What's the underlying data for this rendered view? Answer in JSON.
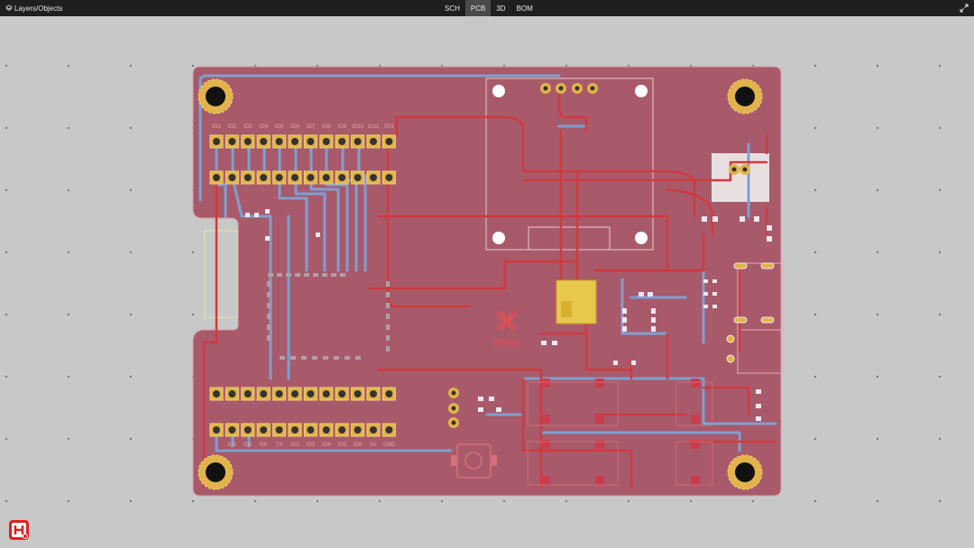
{
  "toolbar": {
    "panel_label": "Layers/Objects",
    "tabs": [
      {
        "label": "SCH",
        "active": false
      },
      {
        "label": "PCB",
        "active": true
      },
      {
        "label": "3D",
        "active": false
      },
      {
        "label": "BOM",
        "active": false
      }
    ]
  },
  "board": {
    "logo_text": "星河日志",
    "header_top_labels": [
      "IO1",
      "IO2",
      "IO3",
      "IO4",
      "IO5",
      "IO6",
      "IO7",
      "IO8",
      "IO9",
      "IO10",
      "IO11",
      "3V3"
    ],
    "header_bottom_labels": [
      "IO0",
      "IO1",
      "RX",
      "TX",
      "IO2",
      "IO3",
      "IO4",
      "IO5",
      "IO6",
      "5V",
      "GND"
    ],
    "colors": {
      "background": "#c8c8c8",
      "board": "#a85a6a",
      "top_copper": "#d03a3f",
      "bottom_copper": "#7f9fd0",
      "pad": "#e1b34a",
      "silk": "#e7a4a4"
    }
  },
  "app": {
    "logo_icon": "lceda-logo-icon"
  }
}
